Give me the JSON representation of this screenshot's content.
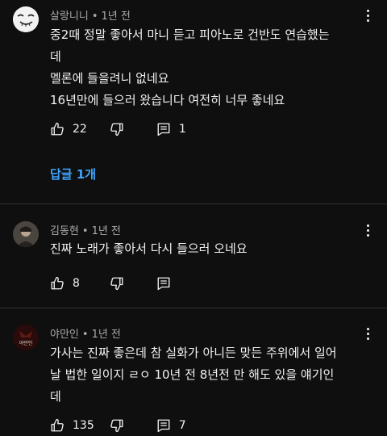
{
  "comments": [
    {
      "author": "살랑니니",
      "time": "1년 전",
      "text": "중2때 정말 좋아서 마니 듣고 피아노로 건반도 연습했는\n데\n멜론에 들을려니 없네요\n16년만에 들으러 왔습니다 여전히 너무 좋네요",
      "likes": "22",
      "replies_count": "1",
      "view_replies": "답글 1개",
      "avatar_icon": "smiley-face-avatar"
    },
    {
      "author": "김동현",
      "time": "1년 전",
      "text": "진짜 노래가 좋아서 다시 들으러 오네요",
      "likes": "8",
      "replies_count": "",
      "avatar_icon": "person-photo-avatar"
    },
    {
      "author": "야만인",
      "time": "1년 전",
      "text": "가사는 진짜 좋은데 참 실화가 아니든 맞든 주위에서 일어\n날 법한 일이지 ㄹㅇ 10년 전 8년전 만 해도 있을 얘기인\n데",
      "likes": "135",
      "replies_count": "7",
      "avatar_icon": "dark-logo-avatar",
      "avatar_label": "야만인"
    }
  ],
  "separator": "•",
  "colors": {
    "background": "#0f0f0f",
    "text": "#f1f1f1",
    "meta": "#aaaaaa",
    "link": "#3ea6ff",
    "divider": "#303030"
  }
}
